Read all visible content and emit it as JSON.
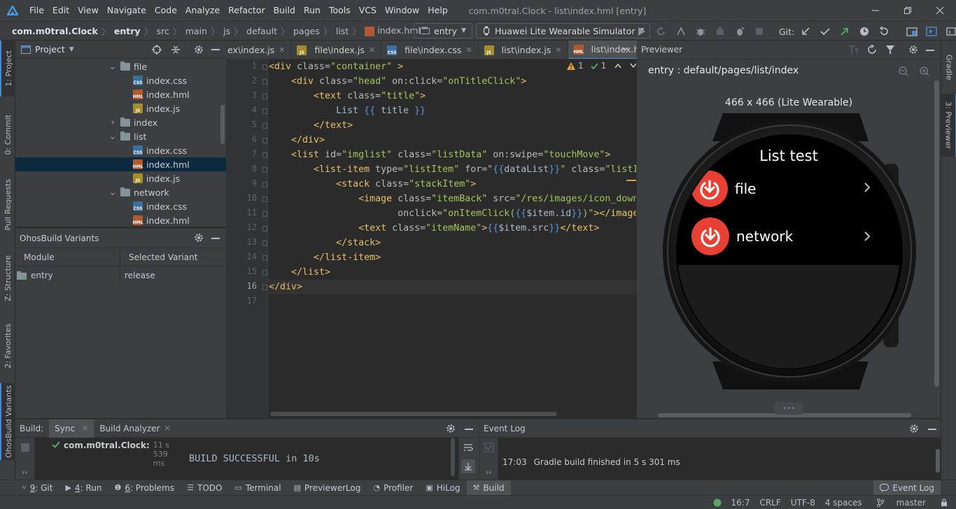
{
  "menubar": {
    "items": [
      "File",
      "Edit",
      "View",
      "Navigate",
      "Code",
      "Analyze",
      "Refactor",
      "Build",
      "Run",
      "Tools",
      "VCS",
      "Window",
      "Help"
    ],
    "window_title": "com.m0tral.Clock - list\\index.hml [entry]"
  },
  "navbar": {
    "crumbs": [
      "com.m0tral.Clock",
      "entry",
      "src",
      "main",
      "js",
      "default",
      "pages",
      "list",
      "index.hml"
    ],
    "module_select": "entry",
    "device_select": "Huawei Lite Wearable Simulator",
    "git_label": "Git:"
  },
  "leftbar": {
    "tabs": [
      "1: Project",
      "0: Commit",
      "Pull Requests",
      "Z: Structure",
      "2: Favorites",
      "OhosBuild Variants"
    ]
  },
  "rightbar": {
    "tabs": [
      "Gradle",
      "3: Previewer"
    ]
  },
  "project": {
    "title": "Project",
    "tree": [
      {
        "label": "file",
        "type": "folder",
        "open": true,
        "level": 0
      },
      {
        "label": "index.css",
        "type": "css",
        "level": 1
      },
      {
        "label": "index.hml",
        "type": "hml",
        "level": 1
      },
      {
        "label": "index.js",
        "type": "js",
        "level": 1
      },
      {
        "label": "index",
        "type": "folder",
        "open": false,
        "level": 0
      },
      {
        "label": "list",
        "type": "folder",
        "open": true,
        "level": 0
      },
      {
        "label": "index.css",
        "type": "css",
        "level": 1
      },
      {
        "label": "index.hml",
        "type": "hml",
        "level": 1,
        "selected": true
      },
      {
        "label": "index.js",
        "type": "js",
        "level": 1
      },
      {
        "label": "network",
        "type": "folder",
        "open": true,
        "level": 0
      },
      {
        "label": "index.css",
        "type": "css",
        "level": 1
      },
      {
        "label": "index.hml",
        "type": "hml",
        "level": 1
      }
    ]
  },
  "ohos": {
    "title": "OhosBuild Variants",
    "col_module": "Module",
    "col_variant": "Selected Variant",
    "row_module": "entry",
    "row_variant": "release"
  },
  "editor": {
    "tabs": [
      {
        "label": "ex\\index.js",
        "type": "js"
      },
      {
        "label": "file\\index.js",
        "type": "js"
      },
      {
        "label": "file\\index.css",
        "type": "css"
      },
      {
        "label": "list\\index.js",
        "type": "js"
      },
      {
        "label": "list\\index.hml",
        "type": "hml",
        "active": true
      }
    ],
    "warnings": "1",
    "oks": "1",
    "current_line": 16,
    "lines": [
      [
        [
          "t",
          "<div "
        ],
        [
          "a",
          "class="
        ],
        [
          "s",
          "\"container\""
        ],
        [
          "t",
          " >"
        ]
      ],
      [
        [
          "t",
          "    <div "
        ],
        [
          "a",
          "class="
        ],
        [
          "s",
          "\"head\""
        ],
        [
          "a",
          " on:click="
        ],
        [
          "s",
          "\"onTitleClick\""
        ],
        [
          "t",
          ">"
        ]
      ],
      [
        [
          "t",
          "        <text "
        ],
        [
          "a",
          "class="
        ],
        [
          "s",
          "\"title\""
        ],
        [
          "t",
          ">"
        ]
      ],
      [
        [
          "w",
          "            List "
        ],
        [
          "b",
          "{{"
        ],
        [
          "w",
          " title "
        ],
        [
          "b",
          "}}"
        ]
      ],
      [
        [
          "t",
          "        </text>"
        ]
      ],
      [
        [
          "t",
          "    </div>"
        ]
      ],
      [
        [
          "t",
          "    <list "
        ],
        [
          "a",
          "id="
        ],
        [
          "s",
          "\"imglist\""
        ],
        [
          "a",
          " class="
        ],
        [
          "s",
          "\"listData\""
        ],
        [
          "a",
          " on:swipe="
        ],
        [
          "s",
          "\"touchMove\""
        ],
        [
          "t",
          ">"
        ]
      ],
      [
        [
          "t",
          "        <list-item "
        ],
        [
          "a",
          "type="
        ],
        [
          "s",
          "\"listItem\""
        ],
        [
          "a",
          " for="
        ],
        [
          "s",
          "\""
        ],
        [
          "b",
          "{{"
        ],
        [
          "w",
          "dataList"
        ],
        [
          "b",
          "}}"
        ],
        [
          "s",
          "\""
        ],
        [
          "a",
          " class="
        ],
        [
          "s",
          "\"listI"
        ]
      ],
      [
        [
          "t",
          "            <stack "
        ],
        [
          "a",
          "class="
        ],
        [
          "s",
          "\"stackItem\""
        ],
        [
          "t",
          ">"
        ]
      ],
      [
        [
          "t",
          "                <image "
        ],
        [
          "a",
          "class="
        ],
        [
          "s",
          "\"itemBack\""
        ],
        [
          "a",
          " src="
        ],
        [
          "s",
          "\"/res/images/icon_down"
        ]
      ],
      [
        [
          "a",
          "                       onclick="
        ],
        [
          "s",
          "\"onItemClick("
        ],
        [
          "b",
          "{{"
        ],
        [
          "w",
          "$item.id"
        ],
        [
          "b",
          "}}"
        ],
        [
          "s",
          ")\""
        ],
        [
          "t",
          "></image"
        ]
      ],
      [
        [
          "t",
          "                <text "
        ],
        [
          "a",
          "class="
        ],
        [
          "s",
          "\"itemName\""
        ],
        [
          "t",
          ">"
        ],
        [
          "b",
          "{{"
        ],
        [
          "w",
          "$item.src"
        ],
        [
          "b",
          "}}"
        ],
        [
          "t",
          "</text>"
        ]
      ],
      [
        [
          "t",
          "            </stack>"
        ]
      ],
      [
        [
          "t",
          "        </list-item>"
        ]
      ],
      [
        [
          "t",
          "    </list>"
        ]
      ],
      [
        [
          "t",
          "</div>"
        ]
      ],
      []
    ]
  },
  "previewer": {
    "title": "Previewer",
    "route": "entry : default/pages/list/index",
    "size_label": "466 x 466 (Lite Wearable)",
    "screen_title": "List test",
    "items": [
      "file",
      "network"
    ]
  },
  "build": {
    "label": "Build:",
    "tab_sync": "Sync",
    "tab_analyzer": "Build Analyzer",
    "tree_item": "com.m0tral.Clock:",
    "tree_time": "11 s 539 ms",
    "output": "BUILD SUCCESSFUL in 10s"
  },
  "eventlog": {
    "title": "Event Log",
    "time": "17:03",
    "message": "Gradle build finished in 5 s 301 ms"
  },
  "toolwindows": [
    {
      "key": "9",
      "label": ": Git",
      "icon": "git-icon"
    },
    {
      "key": "4",
      "label": ": Run",
      "icon": "run-icon"
    },
    {
      "key": "6",
      "label": ": Problems",
      "icon": "problems-icon"
    },
    {
      "key": "",
      "label": "TODO",
      "icon": "todo-icon"
    },
    {
      "key": "",
      "label": "Terminal",
      "icon": "terminal-icon"
    },
    {
      "key": "",
      "label": "PreviewerLog",
      "icon": "log-icon"
    },
    {
      "key": "",
      "label": "Profiler",
      "icon": "profiler-icon"
    },
    {
      "key": "",
      "label": "HiLog",
      "icon": "hilog-icon"
    },
    {
      "key": "",
      "label": "Build",
      "icon": "build-icon",
      "active": true
    }
  ],
  "eventlog_button": "Event Log",
  "status": {
    "position": "16:7",
    "line_sep": "CRLF",
    "encoding": "UTF-8",
    "indent": "4 spaces",
    "branch": "master"
  },
  "colors": {
    "accent": "#4a88c7",
    "tag": "#e8bf6a",
    "attr": "#bababa",
    "string": "#a5c25c",
    "brace": "#5c93d6",
    "warn": "#e6a23c",
    "ok": "#59a869",
    "watch_red": "#e84033"
  }
}
